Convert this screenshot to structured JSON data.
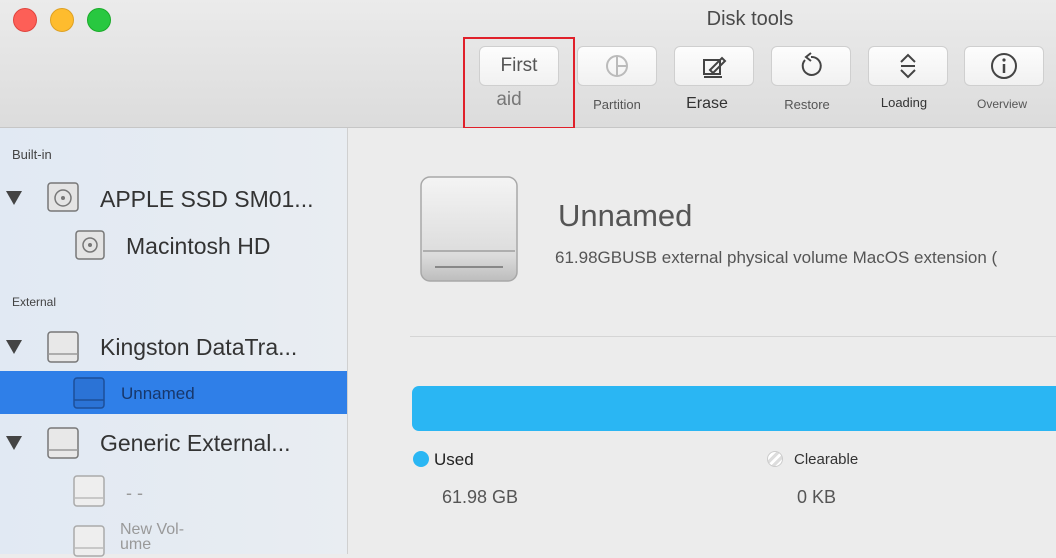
{
  "window": {
    "title": "Disk tools"
  },
  "toolbar": {
    "first_aid_line1": "First",
    "first_aid_line2": "aid",
    "partition": "Partition",
    "erase": "Erase",
    "restore": "Restore",
    "loading": "Loading",
    "overview": "Overview"
  },
  "sidebar": {
    "builtin_label": "Built-in",
    "external_label": "External",
    "items": [
      {
        "label": "APPLE SSD SM01..."
      },
      {
        "label": "Macintosh HD"
      },
      {
        "label": "Kingston DataTra..."
      },
      {
        "label": "Unnamed"
      },
      {
        "label": "Generic External..."
      },
      {
        "label": "- -"
      },
      {
        "label": "New Vol-\nume"
      }
    ]
  },
  "main": {
    "volume_title": "Unnamed",
    "volume_desc": "61.98GBUSB external physical volume MacOS extension (",
    "used_label": "Used",
    "used_value": "61.98 GB",
    "clearable_label": "Clearable",
    "clearable_value": "0 KB"
  },
  "colors": {
    "accent": "#2f7fe8",
    "used": "#2ab6f3",
    "highlight": "#e0202a"
  }
}
